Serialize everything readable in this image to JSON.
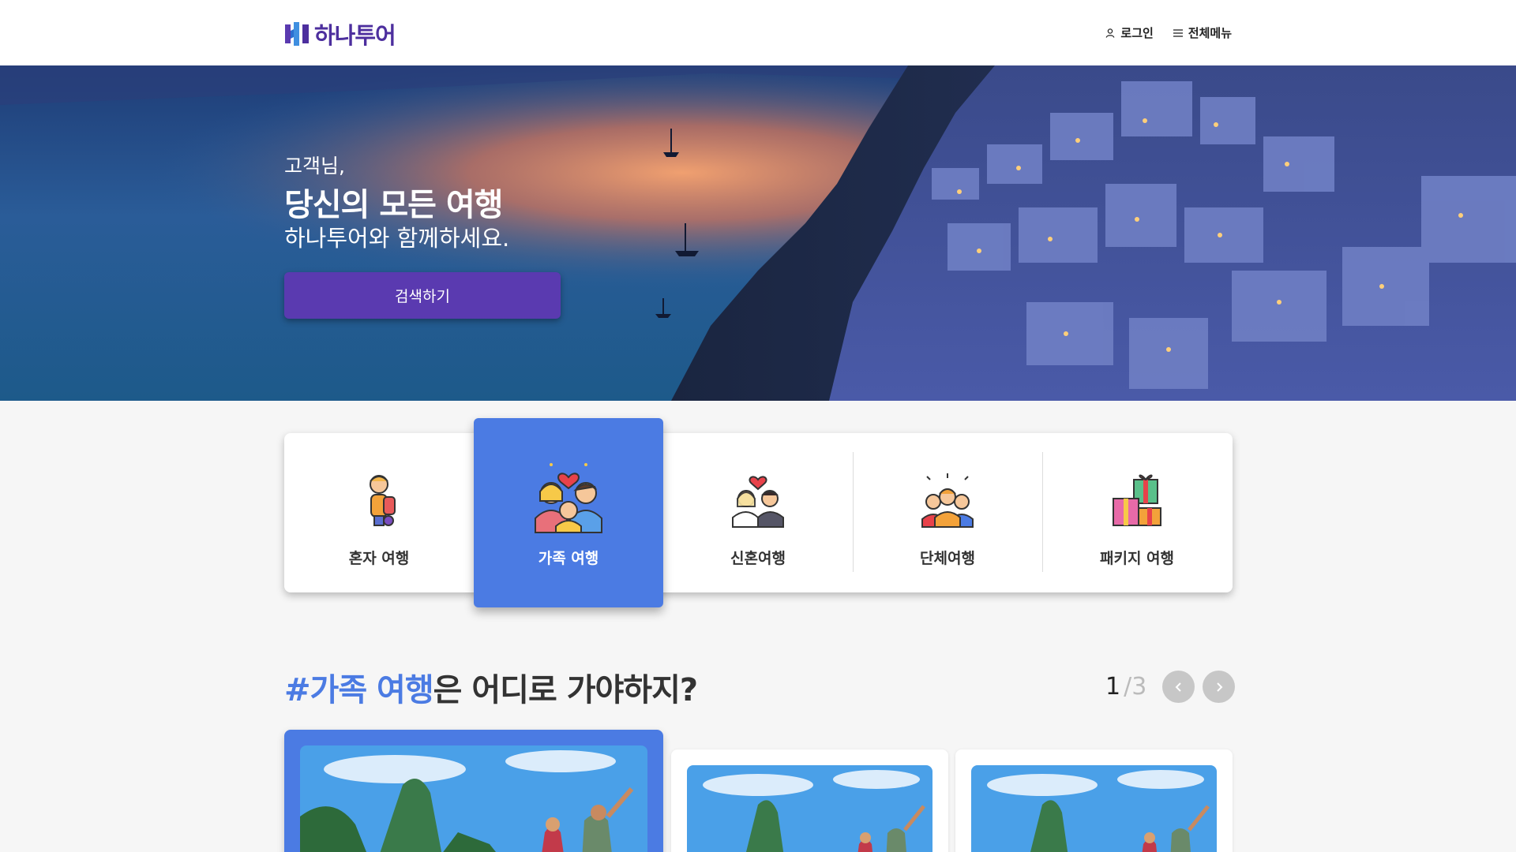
{
  "header": {
    "logo_text": "하나투어",
    "login_label": "로그인",
    "menu_label": "전체메뉴",
    "icons": [
      "user-icon",
      "hamburger-icon"
    ]
  },
  "hero": {
    "greeting": "고객님,",
    "title": "당신의 모든 여행",
    "subtitle": "하나투어와 함께하세요.",
    "search_button": "검색하기"
  },
  "categories": [
    {
      "label": "혼자 여행",
      "icon": "backpacker-icon",
      "active": false
    },
    {
      "label": "가족 여행",
      "icon": "family-icon",
      "active": true
    },
    {
      "label": "신혼여행",
      "icon": "couple-icon",
      "active": false
    },
    {
      "label": "단체여행",
      "icon": "group-icon",
      "active": false
    },
    {
      "label": "패키지 여행",
      "icon": "gift-box-icon",
      "active": false
    }
  ],
  "section": {
    "title_highlight": "#가족 여행",
    "title_rest": "은 어디로 가야하지?",
    "page_current": "1",
    "page_total": "/3"
  },
  "colors": {
    "brand_purple": "#5a3ab0",
    "accent_blue": "#4b7be3",
    "background": "#f6f6f6"
  }
}
